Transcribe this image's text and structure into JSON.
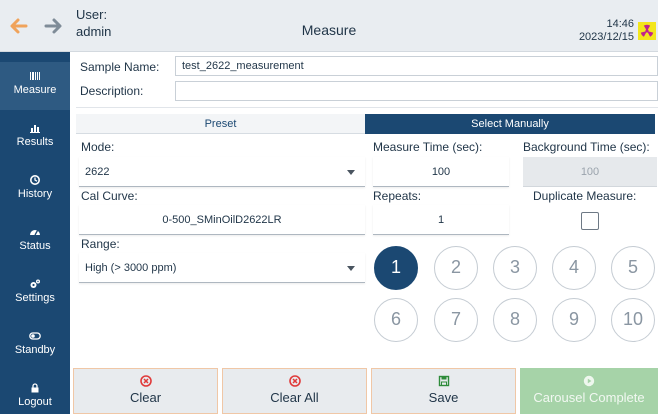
{
  "header": {
    "user_label": "User:",
    "user_name": "admin",
    "title": "Measure",
    "time": "14:46",
    "date": "2023/12/15"
  },
  "colors": {
    "sidebar": "#1b4872",
    "accent": "#1b4872",
    "back_arrow": "#f0a35b",
    "forward_arrow": "#7f8c98",
    "clear_icon": "#e03a3a",
    "save_icon": "#2e8b3a",
    "carousel_disabled": "#a6d3a8",
    "radiation_bg": "#f3e61c",
    "radiation_fg": "#c0238e"
  },
  "sidebar": {
    "items": [
      {
        "label": "Measure",
        "icon": "barcode-icon"
      },
      {
        "label": "Results",
        "icon": "bar-chart-icon"
      },
      {
        "label": "History",
        "icon": "history-icon"
      },
      {
        "label": "Status",
        "icon": "dashboard-icon"
      },
      {
        "label": "Settings",
        "icon": "gears-icon"
      },
      {
        "label": "Standby",
        "icon": "toggle-icon"
      },
      {
        "label": "Logout",
        "icon": "lock-icon"
      }
    ]
  },
  "sample": {
    "name_label": "Sample Name:",
    "name_value": "test_2622_measurement",
    "description_label": "Description:",
    "description_value": ""
  },
  "tabs": {
    "preset": "Preset",
    "manual": "Select Manually"
  },
  "form": {
    "mode_label": "Mode:",
    "mode_value": "2622",
    "cal_curve_label": "Cal Curve:",
    "cal_curve_value": "0-500_SMinOilD2622LR",
    "range_label": "Range:",
    "range_value": "High (> 3000 ppm)",
    "measure_time_label": "Measure Time (sec):",
    "measure_time_value": "100",
    "background_time_label": "Background Time (sec):",
    "background_time_value": "100",
    "repeats_label": "Repeats:",
    "repeats_value": "1",
    "duplicate_label": "Duplicate Measure:",
    "duplicate_checked": false
  },
  "positions": {
    "selected": "1",
    "items": [
      "1",
      "2",
      "3",
      "4",
      "5",
      "6",
      "7",
      "8",
      "9",
      "10"
    ]
  },
  "buttons": {
    "clear": "Clear",
    "clear_all": "Clear All",
    "save": "Save",
    "carousel": "Carousel Complete"
  }
}
